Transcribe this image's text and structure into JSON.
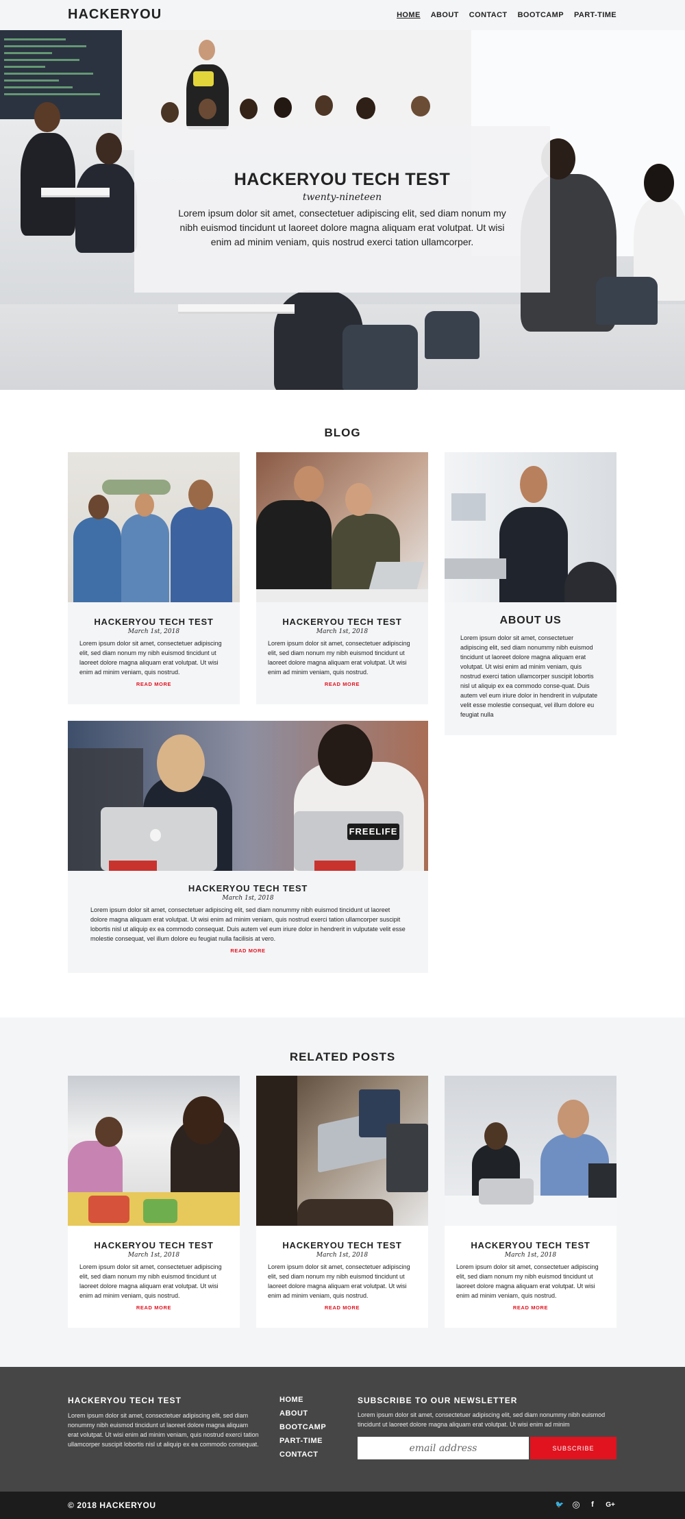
{
  "nav": {
    "logo": "HACKERYOU",
    "items": [
      "HOME",
      "ABOUT",
      "CONTACT",
      "BOOTCAMP",
      "PART-TIME"
    ]
  },
  "hero": {
    "title": "HACKERYOU TECH TEST",
    "subtitle": "twenty-nineteen",
    "text": "Lorem ipsum dolor sit amet, consectetuer adipiscing elit, sed diam nonum my nibh euismod tincidunt ut laoreet dolore magna aliquam erat volutpat. Ut wisi enim ad minim veniam, quis nostrud exerci tation ullamcorper."
  },
  "blog": {
    "heading": "BLOG",
    "posts": [
      {
        "title": "HACKERYOU TECH TEST",
        "date": "March 1st, 2018",
        "text": "Lorem ipsum dolor sit amet, consectetuer adipiscing elit, sed diam nonum my nibh euismod tincidunt ut laoreet dolore magna aliquam erat volutpat. Ut wisi enim ad minim veniam, quis nostrud.",
        "more": "READ MORE"
      },
      {
        "title": "HACKERYOU TECH TEST",
        "date": "March 1st, 2018",
        "text": "Lorem ipsum dolor sit amet, consectetuer adipiscing elit, sed diam nonum my nibh euismod tincidunt ut laoreet dolore magna aliquam erat volutpat. Ut wisi enim ad minim veniam, quis nostrud.",
        "more": "READ MORE"
      },
      {
        "title": "HACKERYOU TECH TEST",
        "date": "March 1st, 2018",
        "text": "Lorem ipsum dolor sit amet, consectetuer adipiscing elit, sed diam nonummy nibh euismod tincidunt ut laoreet dolore magna aliquam erat volutpat. Ut wisi enim ad minim veniam, quis nostrud exerci tation ullamcorper suscipit lobortis nisl ut aliquip ex ea commodo consequat. Duis autem vel eum iriure dolor in hendrerit in vulputate velit esse molestie consequat, vel illum dolore eu feugiat nulla facilisis at vero.",
        "more": "READ MORE"
      }
    ],
    "about": {
      "title": "ABOUT US",
      "text": "Lorem ipsum dolor sit amet, consectetuer adipiscing elit, sed diam nonummy nibh euismod tincidunt ut laoreet dolore magna aliquam erat volutpat. Ut wisi enim ad minim veniam, quis nostrud exerci tation ullamcorper suscipit lobortis nisl ut aliquip ex ea commodo conse-quat. Duis autem vel eum iriure dolor in hendrerit in vulputate velit esse molestie consequat, vel illum dolore eu feugiat nulla"
    }
  },
  "related": {
    "heading": "RELATED POSTS",
    "posts": [
      {
        "title": "HACKERYOU TECH TEST",
        "date": "March 1st, 2018",
        "text": "Lorem ipsum dolor sit amet, consectetuer adipiscing elit, sed diam nonum my nibh euismod tincidunt ut laoreet dolore magna aliquam erat volutpat. Ut wisi enim ad minim veniam, quis nostrud.",
        "more": "READ MORE"
      },
      {
        "title": "HACKERYOU TECH TEST",
        "date": "March 1st, 2018",
        "text": "Lorem ipsum dolor sit amet, consectetuer adipiscing elit, sed diam nonum my nibh euismod tincidunt ut laoreet dolore magna aliquam erat volutpat. Ut wisi enim ad minim veniam, quis nostrud.",
        "more": "READ MORE"
      },
      {
        "title": "HACKERYOU TECH TEST",
        "date": "March 1st, 2018",
        "text": "Lorem ipsum dolor sit amet, consectetuer adipiscing elit, sed diam nonum my nibh euismod tincidunt ut laoreet dolore magna aliquam erat volutpat. Ut wisi enim ad minim veniam, quis nostrud.",
        "more": "READ MORE"
      }
    ]
  },
  "footer": {
    "about_title": "HACKERYOU TECH TEST",
    "about_text": "Lorem ipsum dolor sit amet, consectetuer adipiscing elit, sed diam nonummy nibh euismod tincidunt ut laoreet dolore magna aliquam erat volutpat. Ut wisi enim ad minim veniam, quis nostrud exerci tation ullamcorper suscipit lobortis nisl ut aliquip ex ea commodo consequat.",
    "links": [
      "HOME",
      "ABOUT",
      "BOOTCAMP",
      "PART-TIME",
      "CONTACT"
    ],
    "newsletter_title": "SUBSCRIBE TO OUR NEWSLETTER",
    "newsletter_text": "Lorem ipsum dolor sit amet, consectetuer adipiscing elit, sed diam nonummy nibh euismod tincidunt ut laoreet dolore magna aliquam erat volutpat. Ut wisi enim ad minim",
    "email_placeholder": "email address",
    "subscribe_label": "SUBSCRIBE",
    "copyright": "© 2018 HACKERYOU",
    "social_icons": [
      "twitter-icon",
      "instagram-icon",
      "facebook-icon",
      "google-plus-icon"
    ],
    "social_glyphs": [
      "🐦",
      "◎",
      "f",
      "G+"
    ]
  },
  "colors": {
    "accent": "#e0131f",
    "card_bg": "#f4f5f7",
    "footer_bg": "#464646",
    "bottom_bar_bg": "#1c1c1c"
  }
}
